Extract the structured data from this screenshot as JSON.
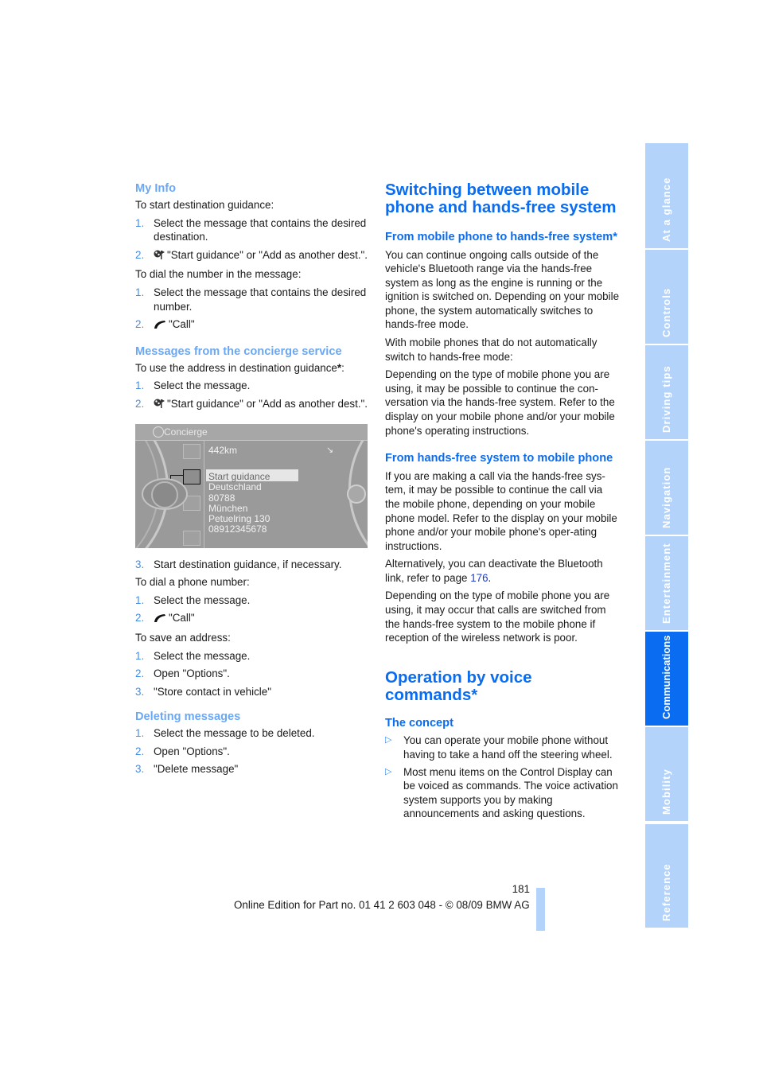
{
  "left": {
    "my_info": {
      "heading": "My Info",
      "intro1": "To start destination guidance:",
      "steps1": [
        {
          "num": "1.",
          "text": "Select the message that contains the desired destination."
        },
        {
          "num": "2.",
          "icon": "navigation-flag-icon",
          "text": "\"Start guidance\" or \"Add as another dest.\"."
        }
      ],
      "intro2": "To dial the number in the message:",
      "steps2": [
        {
          "num": "1.",
          "text": "Select the message that contains the desired number."
        },
        {
          "num": "2.",
          "icon": "phone-handset-icon",
          "text": "\"Call\""
        }
      ]
    },
    "concierge": {
      "heading": "Messages from the concierge service",
      "intro": "To use the address in destination guidance",
      "intro_star": "*",
      "intro_end": ":",
      "steps": [
        {
          "num": "1.",
          "text": "Select the message."
        },
        {
          "num": "2.",
          "icon": "navigation-flag-icon",
          "text": "\"Start guidance\" or \"Add as another dest.\"."
        }
      ],
      "screenshot": {
        "title": "Concierge",
        "distance": "442km",
        "selected_item": "Start guidance",
        "lines": [
          "Deutschland",
          "80788",
          "München",
          "Petuelring 130",
          "08912345678"
        ]
      },
      "steps_after": [
        {
          "num": "3.",
          "text": "Start destination guidance, if necessary."
        }
      ],
      "intro_dial": "To dial a phone number:",
      "steps_dial": [
        {
          "num": "1.",
          "text": "Select the message."
        },
        {
          "num": "2.",
          "icon": "phone-handset-icon",
          "text": "\"Call\""
        }
      ],
      "intro_save": "To save an address:",
      "steps_save": [
        {
          "num": "1.",
          "text": "Select the message."
        },
        {
          "num": "2.",
          "text": "Open \"Options\"."
        },
        {
          "num": "3.",
          "text": "\"Store contact in vehicle\""
        }
      ]
    },
    "deleting": {
      "heading": "Deleting messages",
      "steps": [
        {
          "num": "1.",
          "text": "Select the message to be deleted."
        },
        {
          "num": "2.",
          "text": "Open \"Options\"."
        },
        {
          "num": "3.",
          "text": "\"Delete message\""
        }
      ]
    }
  },
  "right": {
    "switching": {
      "heading": "Switching between mobile phone and hands-free system",
      "sub1": "From mobile phone to hands-free system*",
      "p1": "You can continue ongoing calls outside of the vehicle's Bluetooth range via the hands-free system as long as the engine is running or the ignition is switched on. Depending on your mobile phone, the system automatically switches to hands-free mode.",
      "p2": "With mobile phones that do not automatically switch to hands-free mode:",
      "p3": "Depending on the type of mobile phone you are using, it may be possible to continue the con-versation via the hands-free system. Refer to the display on your mobile phone and/or your mobile phone's operating instructions.",
      "sub2": "From hands-free system to mobile phone",
      "p4": "If you are making a call via the hands-free sys-tem, it may be possible to continue the call via the mobile phone, depending on your mobile phone model. Refer to the display on your mobile phone and/or your mobile phone's oper-ating instructions.",
      "p5_pre": "Alternatively, you can deactivate the Bluetooth link, refer to page ",
      "p5_link": "176",
      "p5_post": ".",
      "p6": "Depending on the type of mobile phone you are using, it may occur that calls are switched from the hands-free system to the mobile phone if reception of the wireless network is poor."
    },
    "voice": {
      "heading": "Operation by voice commands*",
      "sub": "The concept",
      "bullets": [
        "You can operate your mobile phone without having to take a hand off the steering wheel.",
        "Most menu items on the Control Display can be voiced as commands. The voice activation system supports you by making announcements and asking questions."
      ]
    }
  },
  "side_tabs": [
    {
      "label": "At a glance",
      "active": false
    },
    {
      "label": "Controls",
      "active": false
    },
    {
      "label": "Driving tips",
      "active": false
    },
    {
      "label": "Navigation",
      "active": false
    },
    {
      "label": "Entertainment",
      "active": false
    },
    {
      "label": "Communications",
      "active": true
    },
    {
      "label": "Mobility",
      "active": false
    },
    {
      "label": "Reference",
      "active": false
    }
  ],
  "footer": {
    "page_number": "181",
    "edition": "Online Edition for Part no. 01 41 2 603 048 - © 08/09 BMW AG"
  },
  "colors": {
    "heading_blue": "#0a6cf0",
    "subheading_light_blue": "#6aa8f5",
    "tab_inactive": "#b3d3fb",
    "tab_active": "#0a6cf0",
    "link": "#1b3bd6"
  }
}
